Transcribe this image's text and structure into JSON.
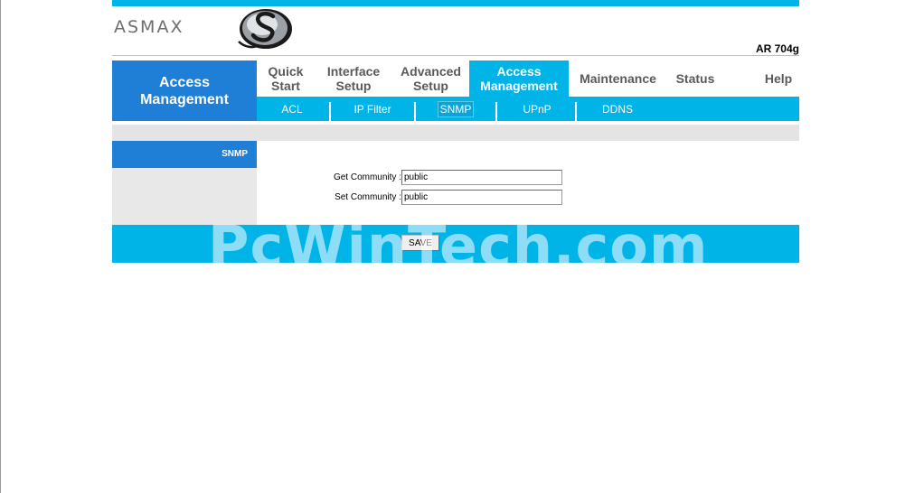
{
  "brand": {
    "logo_text": "ASMAX",
    "model": "AR 704g"
  },
  "nav": {
    "section_title": "Access\nManagement",
    "items": [
      {
        "label": "Quick\nStart"
      },
      {
        "label": "Interface\nSetup"
      },
      {
        "label": "Advanced\nSetup"
      },
      {
        "label": "Access\nManagement",
        "active": true
      },
      {
        "label": "Maintenance"
      },
      {
        "label": "Status"
      },
      {
        "label": "Help"
      }
    ],
    "subitems": [
      {
        "label": "ACL"
      },
      {
        "label": "IP Filter"
      },
      {
        "label": "SNMP",
        "active": true
      },
      {
        "label": "UPnP"
      },
      {
        "label": "DDNS"
      }
    ]
  },
  "sidebar": {
    "heading": "SNMP"
  },
  "form": {
    "get_label": "Get Community :",
    "get_value": "public",
    "set_label": "Set Community :",
    "set_value": "public",
    "save_label": "SAVE"
  },
  "watermark": "PcWinTech.com",
  "colors": {
    "accent": "#00b4e8",
    "nav_blue": "#1f7fd6"
  }
}
